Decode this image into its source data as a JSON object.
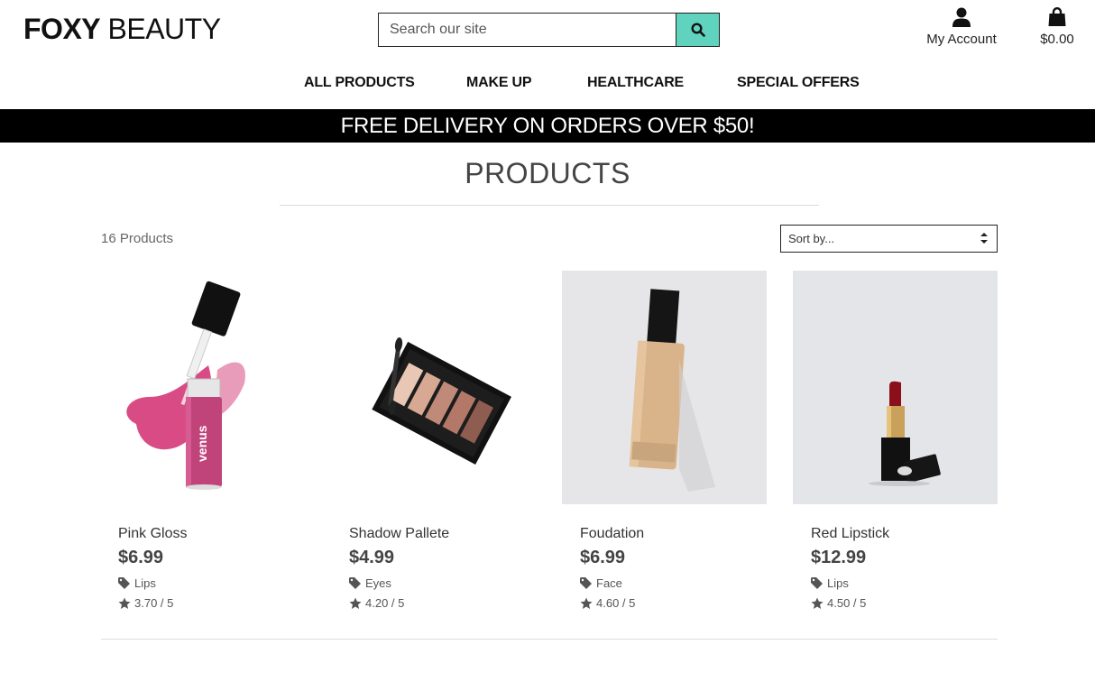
{
  "brand": {
    "part1": "FOXY",
    "part2": "BEAUTY"
  },
  "search": {
    "placeholder": "Search our site"
  },
  "account": {
    "label": "My Account"
  },
  "bag": {
    "total": "$0.00"
  },
  "nav": [
    "ALL PRODUCTS",
    "MAKE UP",
    "HEALTHCARE",
    "SPECIAL OFFERS"
  ],
  "banner": "FREE DELIVERY ON ORDERS OVER $50!",
  "page_title": "PRODUCTS",
  "product_count": "16 Products",
  "sort": {
    "selected": "Sort by..."
  },
  "accent_color": "#5fd3bd",
  "products": [
    {
      "name": "Pink Gloss",
      "price": "$6.99",
      "category": "Lips",
      "rating": "3.70 / 5"
    },
    {
      "name": "Shadow Pallete",
      "price": "$4.99",
      "category": "Eyes",
      "rating": "4.20 / 5"
    },
    {
      "name": "Foudation",
      "price": "$6.99",
      "category": "Face",
      "rating": "4.60 / 5"
    },
    {
      "name": "Red Lipstick",
      "price": "$12.99",
      "category": "Lips",
      "rating": "4.50 / 5"
    }
  ]
}
